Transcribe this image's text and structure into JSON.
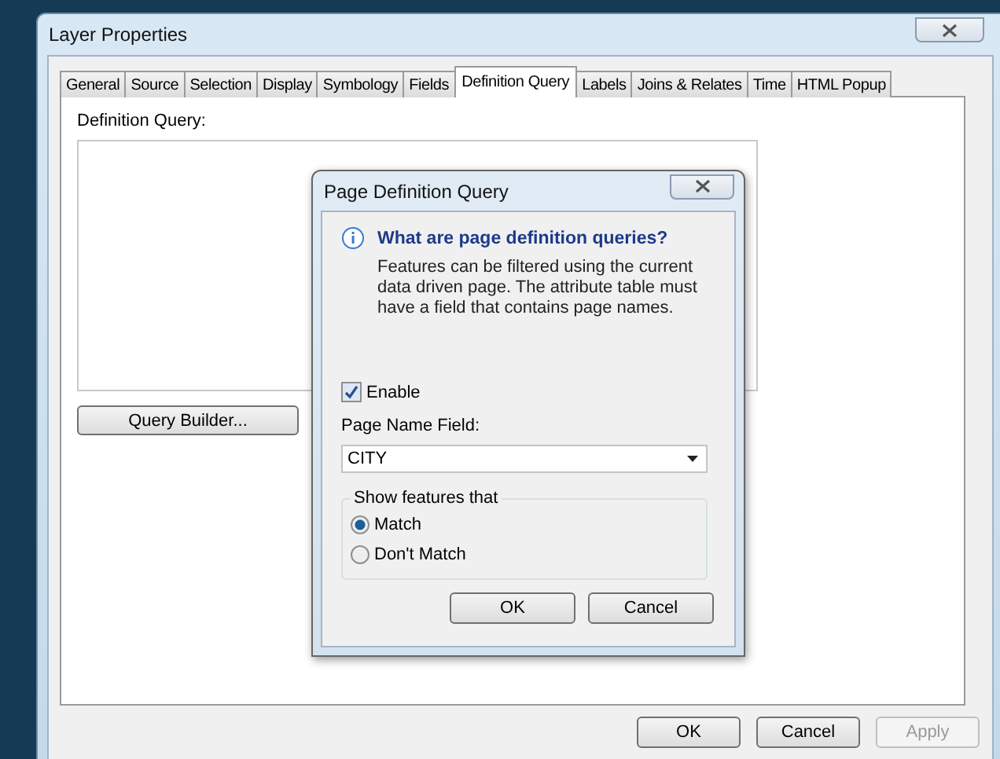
{
  "window": {
    "title": "Layer Properties"
  },
  "tabs": [
    {
      "label": "General",
      "selected": false
    },
    {
      "label": "Source",
      "selected": false
    },
    {
      "label": "Selection",
      "selected": false
    },
    {
      "label": "Display",
      "selected": false
    },
    {
      "label": "Symbology",
      "selected": false
    },
    {
      "label": "Fields",
      "selected": false
    },
    {
      "label": "Definition Query",
      "selected": true
    },
    {
      "label": "Labels",
      "selected": false
    },
    {
      "label": "Joins & Relates",
      "selected": false
    },
    {
      "label": "Time",
      "selected": false
    },
    {
      "label": "HTML Popup",
      "selected": false
    }
  ],
  "definition_query": {
    "label": "Definition Query:",
    "button": "Query Builder..."
  },
  "buttons": [
    {
      "label": "OK",
      "disabled": false
    },
    {
      "label": "Cancel",
      "disabled": false
    },
    {
      "label": "Apply",
      "disabled": true
    }
  ],
  "dialog": {
    "title": "Page Definition Query",
    "heading": "What are page definition queries?",
    "description": "Features can be filtered using the current data driven page.  The attribute table must have a field that contains page names.",
    "enable": {
      "label": "Enable",
      "checked": true
    },
    "field_label": "Page Name Field:",
    "field_value": "CITY",
    "group_label": "Show features that",
    "options": [
      {
        "label": "Match",
        "selected": true
      },
      {
        "label": "Don't Match",
        "selected": false
      }
    ],
    "buttons": [
      "OK",
      "Cancel"
    ]
  }
}
